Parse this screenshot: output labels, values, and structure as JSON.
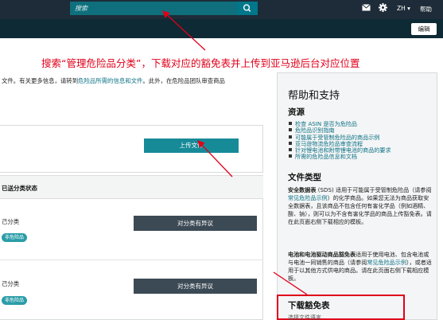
{
  "search": {
    "placeholder": "搜索",
    "value": ""
  },
  "topbar": {
    "lang": "ZH ▾",
    "help": "帮助"
  },
  "subbar": {
    "edit_label": "编辑"
  },
  "annotation": "搜索“管理危险品分类”，下载对应的豁免表并上传到亚马逊后台对应位置",
  "intro": {
    "prefix": "文件。有关更多信息，请转到",
    "link1": "危险品所需的信息和文件",
    "middle": "。此外，在危险品团队审查商品"
  },
  "upload_label": "上传文件",
  "section_title": "已送分类状态",
  "rows": [
    {
      "label": "己分类",
      "badge": "非危险品",
      "button": "对分类有异议"
    },
    {
      "label": "己分类",
      "badge": "非危险品",
      "button": "对分类有异议"
    }
  ],
  "help": {
    "title": "帮助和支持",
    "resources_title": "资源",
    "resources": [
      "检查 ASIN 是否为危险品",
      "危险品识别指南",
      "可能属于受管制危险品的商品示例",
      "亚马逊物流危险品审查流程",
      "针对锂电池和附带锂电池的商品的要求",
      "所需的危险品信息和文档"
    ],
    "filetypes_title": "文件类型",
    "sds_bold": "安全数据表",
    "sds_text": " (SDS) 适用于可能属于受管制危险品（请参阅",
    "sds_link": "常见危险品示例",
    "sds_text2": "）的化学商品。如果您无法为商品获取安全数据表，且该商品不包含任何有害化学品（例如酒精、酸、钠），则可以为不含有害化学品的商品上传豁免表。请在此页面右侧下载相应的模板。",
    "battery_bold": "电池和电池驱动商品豁免表",
    "battery_text": "适用于使用电池、包含电池或与电池一同销售的商品（请参阅",
    "battery_link": "常见危险品示例",
    "battery_text2": "），或者适用于以其他方式供电的商品。请在此页面右侧下载相应模板。",
    "download_title": "下载豁免表",
    "download_sub": "选择文件语言"
  },
  "colors": {
    "annotation": "#e0001a",
    "accent": "#178a98",
    "topbar": "#1d2c38"
  }
}
